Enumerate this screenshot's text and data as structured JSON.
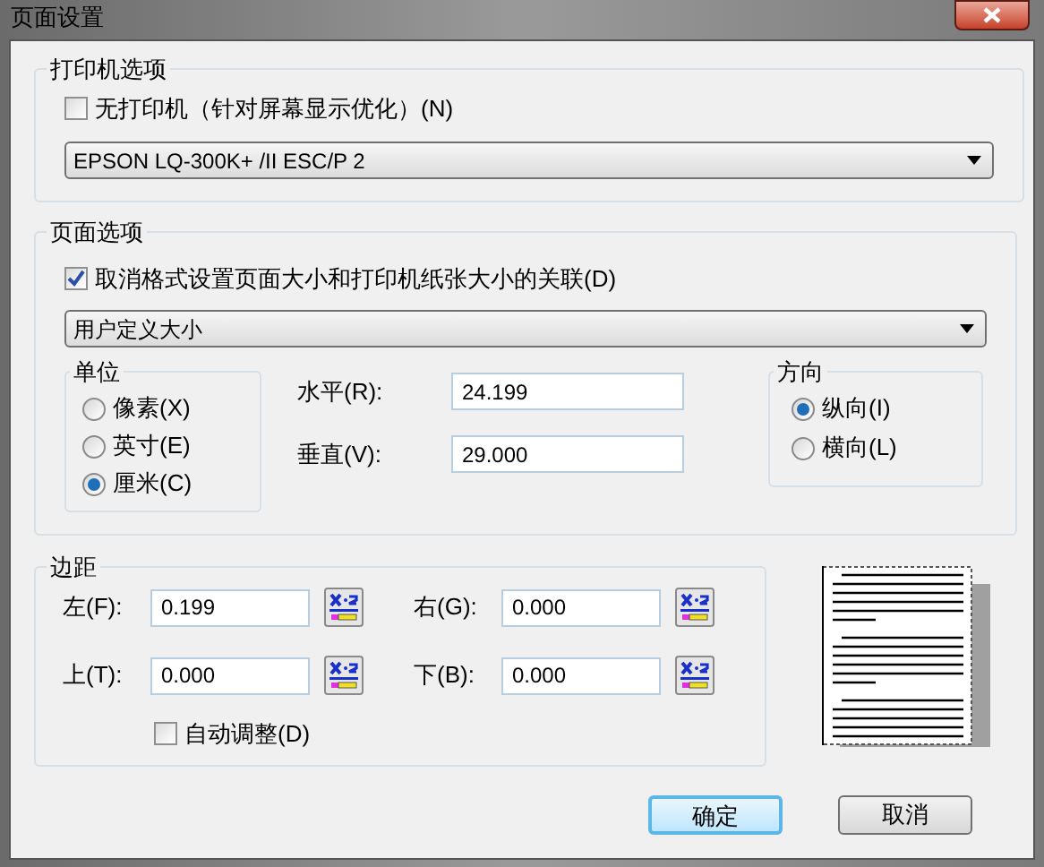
{
  "window": {
    "title": "页面设置"
  },
  "printer_options": {
    "title": "打印机选项",
    "no_printer": {
      "label": "无打印机（针对屏幕显示优化）(N)",
      "checked": false
    },
    "printer": "EPSON LQ-300K+ /II ESC/P 2"
  },
  "page_options": {
    "title": "页面选项",
    "unlink": {
      "label": "取消格式设置页面大小和打印机纸张大小的关联(D)",
      "checked": true
    },
    "paper_size": "用户定义大小",
    "units": {
      "title": "单位",
      "options": [
        {
          "label": "像素(X)",
          "selected": false
        },
        {
          "label": "英寸(E)",
          "selected": false
        },
        {
          "label": "厘米(C)",
          "selected": true
        }
      ]
    },
    "size_fields": [
      {
        "label": "水平(R):",
        "value": "24.199"
      },
      {
        "label": "垂直(V):",
        "value": "29.000"
      }
    ],
    "orientation": {
      "title": "方向",
      "options": [
        {
          "label": "纵向(I)",
          "selected": true
        },
        {
          "label": "横向(L)",
          "selected": false
        }
      ]
    }
  },
  "margins": {
    "title": "边距",
    "fields": [
      {
        "label": "左(F):",
        "value": "0.199"
      },
      {
        "label": "右(G):",
        "value": "0.000"
      },
      {
        "label": "上(T):",
        "value": "0.000"
      },
      {
        "label": "下(B):",
        "value": "0.000"
      }
    ],
    "auto_adjust": {
      "label": "自动调整(D)",
      "checked": false
    }
  },
  "buttons": [
    {
      "label": "确定",
      "default": true
    },
    {
      "label": "取消",
      "default": false
    }
  ]
}
